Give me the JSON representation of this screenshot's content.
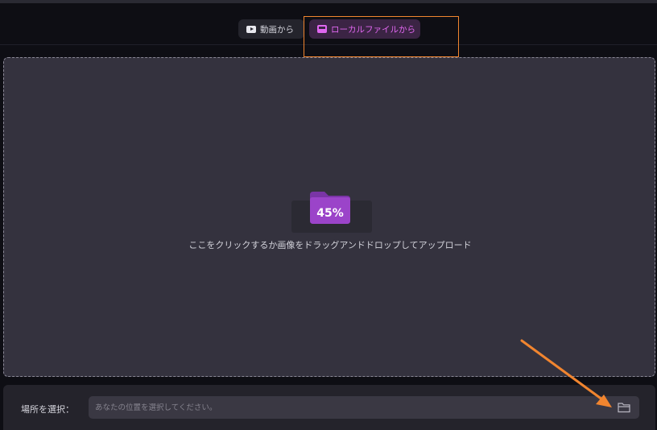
{
  "tabs": [
    {
      "label": "動画から",
      "icon": "youtube-icon",
      "active": false
    },
    {
      "label": "ローカルファイルから",
      "icon": "computer-icon",
      "active": true
    }
  ],
  "upload": {
    "progress_percent": 45,
    "progress_label": "45%",
    "instruction": "ここをクリックするか画像をドラッグアンドドロップしてアップロード",
    "icon": "folder-icon"
  },
  "location": {
    "label": "場所を選択：",
    "value": "",
    "placeholder": "あなたの位置を選択してください。",
    "button_icon": "folder-open-icon"
  },
  "colors": {
    "accent": "#e067f0",
    "active_tab_bg": "#3b2444",
    "annotation": "#f1852f",
    "folder": "#9b44c9"
  }
}
